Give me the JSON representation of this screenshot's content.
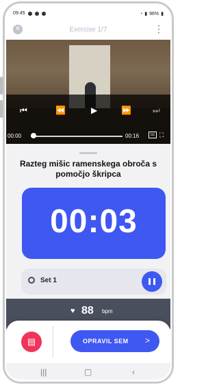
{
  "statusbar": {
    "time": "09:45",
    "battery": "96%"
  },
  "header": {
    "title": "Exercise  1/7"
  },
  "video": {
    "current_time": "00:00",
    "duration": "00:16",
    "progress": 0.0,
    "cc_label": "cc"
  },
  "exercise": {
    "title": "Razteg mišic ramenskega obroča s pomočjo škripca",
    "timer": "00:03"
  },
  "set": {
    "label": "Set 1"
  },
  "heart_rate": {
    "value": "88",
    "unit": "bpm"
  },
  "actions": {
    "done_label": "OPRAVIL SEM",
    "done_chevron": ">"
  },
  "colors": {
    "accent": "#3f58f1",
    "danger": "#f0345b",
    "dark_band": "#4a4f5d"
  },
  "icons": {
    "close": "close-icon",
    "menu": "more-vertical-icon",
    "play": "play-icon",
    "pause": "pause-icon",
    "heart": "heart-icon",
    "document": "document-icon"
  }
}
